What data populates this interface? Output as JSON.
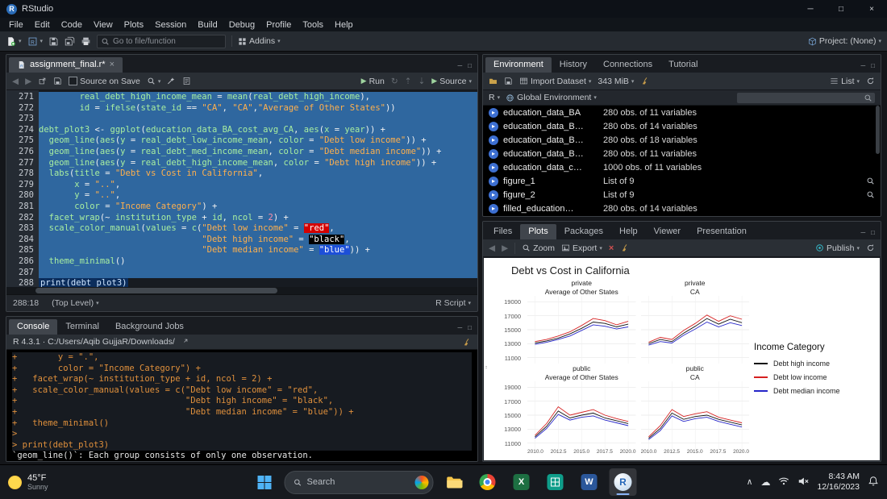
{
  "titlebar": {
    "app": "RStudio"
  },
  "menubar": {
    "items": [
      "File",
      "Edit",
      "Code",
      "View",
      "Plots",
      "Session",
      "Build",
      "Debug",
      "Profile",
      "Tools",
      "Help"
    ]
  },
  "toolbar": {
    "goto_placeholder": "Go to file/function",
    "addins": "Addins",
    "project": "Project: (None)"
  },
  "editor": {
    "tab": "assignment_final.r*",
    "source_on_save": "Source on Save",
    "run": "Run",
    "source_btn": "Source",
    "status_pos": "288:18",
    "status_scope": "(Top Level)",
    "status_type": "R Script",
    "lines": [
      {
        "n": 271,
        "sel": true,
        "tokens": [
          [
            "p",
            "        real_debt_high_income_mean "
          ],
          [
            "o",
            "= "
          ],
          [
            "p",
            "mean"
          ],
          [
            "o",
            "("
          ],
          [
            "p",
            "real_debt_high_income"
          ],
          [
            "o",
            "),"
          ]
        ]
      },
      {
        "n": 272,
        "sel": true,
        "tokens": [
          [
            "p",
            "        id "
          ],
          [
            "o",
            "= "
          ],
          [
            "p",
            "ifelse"
          ],
          [
            "o",
            "("
          ],
          [
            "p",
            "state_id "
          ],
          [
            "o",
            "== "
          ],
          [
            "s",
            "\"CA\""
          ],
          [
            "o",
            ", "
          ],
          [
            "s",
            "\"CA\""
          ],
          [
            "o",
            ","
          ],
          [
            "s",
            "\"Average of Other States\""
          ],
          [
            "o",
            "))"
          ]
        ]
      },
      {
        "n": 273,
        "sel": true,
        "tokens": []
      },
      {
        "n": 274,
        "sel": true,
        "tokens": [
          [
            "p",
            "debt_plot3 "
          ],
          [
            "o",
            "<- "
          ],
          [
            "p",
            "ggplot"
          ],
          [
            "o",
            "("
          ],
          [
            "p",
            "education_data_BA_cost_avg_CA"
          ],
          [
            "o",
            ", "
          ],
          [
            "p",
            "aes"
          ],
          [
            "o",
            "("
          ],
          [
            "p",
            "x "
          ],
          [
            "o",
            "= "
          ],
          [
            "p",
            "year"
          ],
          [
            "o",
            ")) +"
          ]
        ]
      },
      {
        "n": 275,
        "sel": true,
        "tokens": [
          [
            "p",
            "  geom_line"
          ],
          [
            "o",
            "("
          ],
          [
            "p",
            "aes"
          ],
          [
            "o",
            "("
          ],
          [
            "p",
            "y "
          ],
          [
            "o",
            "= "
          ],
          [
            "p",
            "real_debt_low_income_mean"
          ],
          [
            "o",
            ", "
          ],
          [
            "p",
            "color "
          ],
          [
            "o",
            "= "
          ],
          [
            "s",
            "\"Debt low income\""
          ],
          [
            "o",
            ")) +"
          ]
        ]
      },
      {
        "n": 276,
        "sel": true,
        "tokens": [
          [
            "p",
            "  geom_line"
          ],
          [
            "o",
            "("
          ],
          [
            "p",
            "aes"
          ],
          [
            "o",
            "("
          ],
          [
            "p",
            "y "
          ],
          [
            "o",
            "= "
          ],
          [
            "p",
            "real_debt_med_income_mean"
          ],
          [
            "o",
            ", "
          ],
          [
            "p",
            "color "
          ],
          [
            "o",
            "= "
          ],
          [
            "s",
            "\"Debt median income\""
          ],
          [
            "o",
            ")) +"
          ]
        ]
      },
      {
        "n": 277,
        "sel": true,
        "tokens": [
          [
            "p",
            "  geom_line"
          ],
          [
            "o",
            "("
          ],
          [
            "p",
            "aes"
          ],
          [
            "o",
            "("
          ],
          [
            "p",
            "y "
          ],
          [
            "o",
            "= "
          ],
          [
            "p",
            "real_debt_high_income_mean"
          ],
          [
            "o",
            ", "
          ],
          [
            "p",
            "color "
          ],
          [
            "o",
            "= "
          ],
          [
            "s",
            "\"Debt high income\""
          ],
          [
            "o",
            ")) +"
          ]
        ]
      },
      {
        "n": 278,
        "sel": true,
        "tokens": [
          [
            "p",
            "  labs"
          ],
          [
            "o",
            "("
          ],
          [
            "p",
            "title "
          ],
          [
            "o",
            "= "
          ],
          [
            "s",
            "\"Debt vs Cost in California\""
          ],
          [
            "o",
            ","
          ]
        ]
      },
      {
        "n": 279,
        "sel": true,
        "tokens": [
          [
            "p",
            "       x "
          ],
          [
            "o",
            "= "
          ],
          [
            "s",
            "\"..\""
          ],
          [
            "o",
            ","
          ]
        ]
      },
      {
        "n": 280,
        "sel": true,
        "tokens": [
          [
            "p",
            "       y "
          ],
          [
            "o",
            "= "
          ],
          [
            "s",
            "\"..\""
          ],
          [
            "o",
            ","
          ]
        ]
      },
      {
        "n": 281,
        "sel": true,
        "tokens": [
          [
            "p",
            "       color "
          ],
          [
            "o",
            "= "
          ],
          [
            "s",
            "\"Income Category\""
          ],
          [
            "o",
            ") +"
          ]
        ]
      },
      {
        "n": 282,
        "sel": true,
        "tokens": [
          [
            "p",
            "  facet_wrap"
          ],
          [
            "o",
            "(~ "
          ],
          [
            "p",
            "institution_type "
          ],
          [
            "o",
            "+ "
          ],
          [
            "p",
            "id"
          ],
          [
            "o",
            ", "
          ],
          [
            "p",
            "ncol "
          ],
          [
            "o",
            "= "
          ],
          [
            "n",
            "2"
          ],
          [
            "o",
            ") +"
          ]
        ]
      },
      {
        "n": 283,
        "sel": true,
        "tokens": [
          [
            "p",
            "  scale_color_manual"
          ],
          [
            "o",
            "("
          ],
          [
            "p",
            "values "
          ],
          [
            "o",
            "= "
          ],
          [
            "p",
            "c"
          ],
          [
            "o",
            "("
          ],
          [
            "s",
            "\"Debt low income\" "
          ],
          [
            "o",
            "= "
          ],
          [
            "cr",
            "\"red\""
          ],
          [
            "o",
            ","
          ]
        ]
      },
      {
        "n": 284,
        "sel": true,
        "tokens": [
          [
            "p",
            "                                "
          ],
          [
            "s",
            "\"Debt high income\" "
          ],
          [
            "o",
            "= "
          ],
          [
            "cb",
            "\"black\""
          ],
          [
            "o",
            ","
          ]
        ]
      },
      {
        "n": 285,
        "sel": true,
        "tokens": [
          [
            "p",
            "                                "
          ],
          [
            "s",
            "\"Debt median income\" "
          ],
          [
            "o",
            "= "
          ],
          [
            "cu",
            "\"blue\""
          ],
          [
            "o",
            ")) +"
          ]
        ]
      },
      {
        "n": 286,
        "sel": true,
        "tokens": [
          [
            "p",
            "  theme_minimal"
          ],
          [
            "o",
            "()"
          ]
        ]
      },
      {
        "n": 287,
        "sel": true,
        "tokens": []
      },
      {
        "n": 288,
        "sel": false,
        "tokens": [
          [
            "hl",
            "print(debt_plot3)"
          ]
        ]
      }
    ]
  },
  "console": {
    "tabs": [
      "Console",
      "Terminal",
      "Background Jobs"
    ],
    "header": "R 4.3.1 · C:/Users/Aqib GujjaR/Downloads/",
    "lines": [
      {
        "c": "code",
        "text": "+        y = \".\","
      },
      {
        "c": "code",
        "text": "+        color = \"Income Category\") +"
      },
      {
        "c": "code",
        "text": "+   facet_wrap(~ institution_type + id, ncol = 2) +"
      },
      {
        "c": "code",
        "text": "+   scale_color_manual(values = c(\"Debt low income\" = \"red\","
      },
      {
        "c": "code",
        "text": "+                                 \"Debt high income\" = \"black\","
      },
      {
        "c": "code",
        "text": "+                                 \"Debt median income\" = \"blue\")) +"
      },
      {
        "c": "code",
        "text": "+   theme_minimal()"
      },
      {
        "c": "code",
        "text": ">"
      },
      {
        "c": "code",
        "text": "> print(debt_plot3)"
      },
      {
        "c": "msg",
        "text": "`geom_line()`: Each group consists of only one observation."
      }
    ]
  },
  "environment": {
    "tabs": [
      "Environment",
      "History",
      "Connections",
      "Tutorial"
    ],
    "import_dataset": "Import Dataset",
    "memory": "343 MiB",
    "view_mode": "List",
    "lang": "R",
    "scope": "Global Environment",
    "rows": [
      {
        "name": "education_data_BA",
        "value": "280 obs. of 11 variables",
        "kind": "df"
      },
      {
        "name": "education_data_B…",
        "value": "280 obs. of 14 variables",
        "kind": "df"
      },
      {
        "name": "education_data_B…",
        "value": "280 obs. of 18 variables",
        "kind": "df"
      },
      {
        "name": "education_data_B…",
        "value": "280 obs. of 11 variables",
        "kind": "df"
      },
      {
        "name": "education_data_c…",
        "value": "1000 obs. of 11 variables",
        "kind": "df"
      },
      {
        "name": "figure_1",
        "value": "List of 9",
        "kind": "list"
      },
      {
        "name": "figure_2",
        "value": "List of 9",
        "kind": "list"
      },
      {
        "name": "filled_education…",
        "value": "280 obs. of 14 variables",
        "kind": "df"
      }
    ]
  },
  "plots": {
    "tabs": [
      "Files",
      "Plots",
      "Packages",
      "Help",
      "Viewer",
      "Presentation"
    ],
    "zoom": "Zoom",
    "export": "Export",
    "publish": "Publish"
  },
  "chart_data": {
    "type": "line",
    "title": "Debt vs Cost in California",
    "xlabel": "..",
    "ylabel": "..",
    "legend_title": "Income Category",
    "legend": [
      {
        "key": "high",
        "label": "Debt high income",
        "color": "#111111"
      },
      {
        "key": "low",
        "label": "Debt low income",
        "color": "#d62020"
      },
      {
        "key": "median",
        "label": "Debt median income",
        "color": "#2525c8"
      }
    ],
    "y_ticks": [
      19000,
      17000,
      15000,
      13000,
      11000
    ],
    "ylim": [
      10500,
      19500
    ],
    "x_ticks": [
      "2010.0",
      "2012.5",
      "2015.0",
      "2017.5",
      "2020.0"
    ],
    "xlim": [
      2009.5,
      2020.5
    ],
    "x": [
      2010,
      2011.25,
      2012.5,
      2013.75,
      2015,
      2016.25,
      2017.5,
      2018.75,
      2020
    ],
    "facets": [
      {
        "strip1": "private",
        "strip2": "Average of Other States",
        "series": {
          "low": [
            13300,
            13600,
            14100,
            14700,
            15600,
            16600,
            16300,
            15700,
            16200
          ],
          "high": [
            13100,
            13400,
            13800,
            14400,
            15200,
            16100,
            15900,
            15400,
            15800
          ],
          "median": [
            12900,
            13200,
            13600,
            14100,
            14900,
            15700,
            15500,
            15100,
            15400
          ]
        }
      },
      {
        "strip1": "private",
        "strip2": "CA",
        "series": {
          "low": [
            13200,
            13900,
            13600,
            14900,
            15900,
            17100,
            16200,
            17000,
            16500
          ],
          "high": [
            13000,
            13600,
            13300,
            14500,
            15500,
            16600,
            15800,
            16500,
            16000
          ],
          "median": [
            12800,
            13300,
            13100,
            14200,
            15100,
            16100,
            15400,
            16000,
            15600
          ]
        }
      },
      {
        "strip1": "public",
        "strip2": "Average of Other States",
        "series": {
          "low": [
            12100,
            13800,
            16200,
            15000,
            15400,
            15800,
            15000,
            14500,
            14100
          ],
          "high": [
            11900,
            13400,
            15600,
            14600,
            15000,
            15300,
            14600,
            14200,
            13800
          ],
          "median": [
            11700,
            13100,
            15100,
            14300,
            14700,
            14900,
            14300,
            13900,
            13500
          ]
        }
      },
      {
        "strip1": "public",
        "strip2": "CA",
        "series": {
          "low": [
            11900,
            13500,
            15800,
            14800,
            15200,
            15500,
            14700,
            14300,
            13900
          ],
          "high": [
            11700,
            13100,
            15300,
            14400,
            14800,
            15000,
            14400,
            14000,
            13600
          ],
          "median": [
            11500,
            12800,
            14900,
            14100,
            14500,
            14700,
            14100,
            13700,
            13300
          ]
        }
      }
    ]
  },
  "taskbar": {
    "weather_temp": "45°F",
    "weather_desc": "Sunny",
    "search_placeholder": "Search",
    "time": "8:43 AM",
    "date": "12/16/2023"
  }
}
